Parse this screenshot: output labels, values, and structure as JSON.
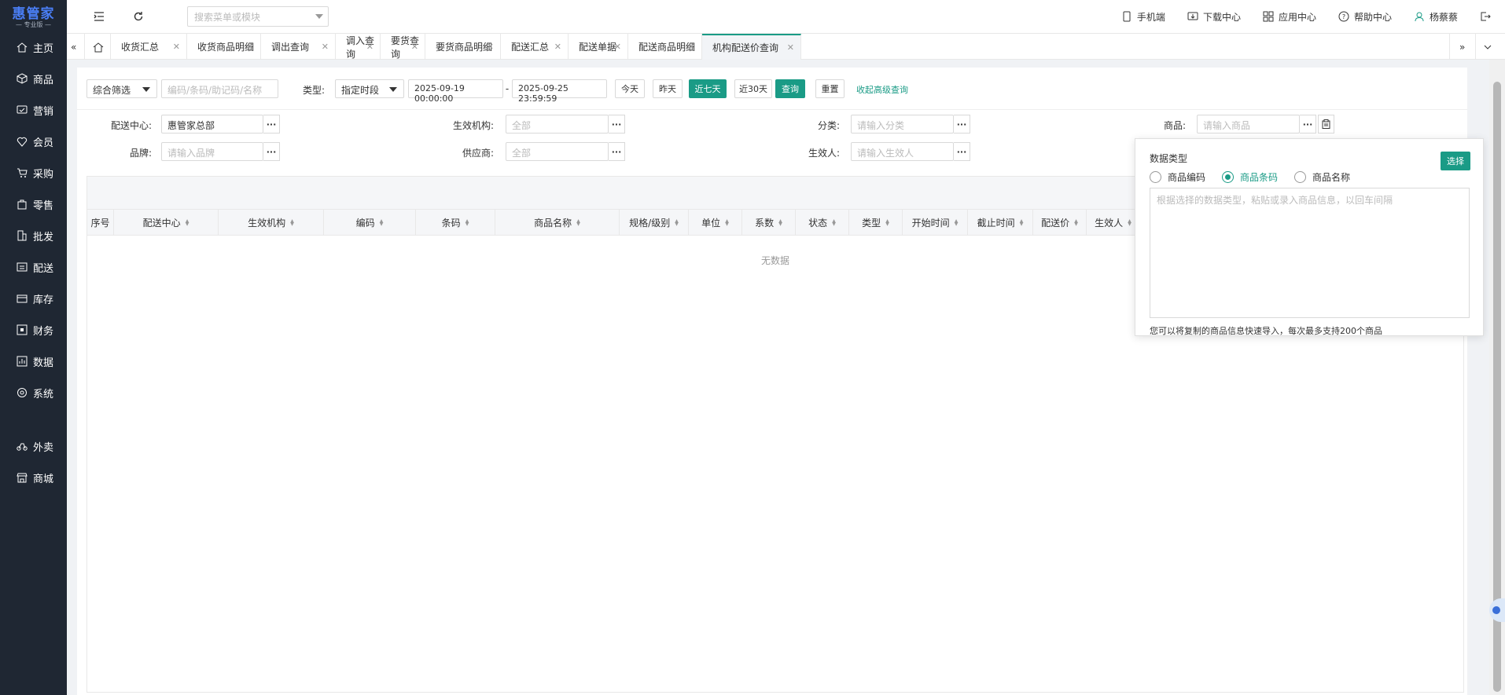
{
  "sidebar": {
    "logo_title": "惠管家",
    "logo_sub": "— 专业版 —",
    "items": [
      {
        "label": "主页",
        "icon": "home-icon"
      },
      {
        "label": "商品",
        "icon": "cube-icon"
      },
      {
        "label": "营销",
        "icon": "marketing-icon"
      },
      {
        "label": "会员",
        "icon": "member-icon"
      },
      {
        "label": "采购",
        "icon": "cart-icon"
      },
      {
        "label": "零售",
        "icon": "bag-icon"
      },
      {
        "label": "批发",
        "icon": "building-icon"
      },
      {
        "label": "配送",
        "icon": "truck-icon"
      },
      {
        "label": "库存",
        "icon": "box-icon"
      },
      {
        "label": "财务",
        "icon": "finance-icon"
      },
      {
        "label": "数据",
        "icon": "chart-icon"
      },
      {
        "label": "系统",
        "icon": "settings-icon"
      }
    ],
    "items2": [
      {
        "label": "外卖",
        "icon": "bike-icon"
      },
      {
        "label": "商城",
        "icon": "store-icon"
      }
    ]
  },
  "topbar": {
    "search_placeholder": "搜索菜单或模块",
    "links": [
      "手机端",
      "下载中心",
      "应用中心",
      "帮助中心",
      "杨蔡蔡"
    ]
  },
  "tabs": [
    "收货汇总",
    "收货商品明细",
    "调出查询",
    "调入查询",
    "要货查询",
    "要货商品明细",
    "配送汇总",
    "配送单据",
    "配送商品明细",
    "机构配送价查询"
  ],
  "filters": {
    "combo_label": "综合筛选",
    "code_placeholder": "编码/条码/助记码/名称",
    "type_label": "类型:",
    "type_value": "指定时段",
    "date_start": "2025-09-19 00:00:00",
    "date_sep": "-",
    "date_end": "2025-09-25 23:59:59",
    "btn_today": "今天",
    "btn_yesterday": "昨天",
    "btn_7days": "近七天",
    "btn_30days": "近30天",
    "btn_query": "查询",
    "btn_reset": "重置",
    "collapse_link": "收起高级查询",
    "center_label": "配送中心:",
    "center_value": "惠管家总部",
    "org_label": "生效机构:",
    "org_placeholder": "全部",
    "category_label": "分类:",
    "category_placeholder": "请输入分类",
    "product_label": "商品:",
    "product_placeholder": "请输入商品",
    "brand_label": "品牌:",
    "brand_placeholder": "请输入品牌",
    "supplier_label": "供应商:",
    "supplier_placeholder": "全部",
    "effector_label": "生效人:",
    "effector_placeholder": "请输入生效人",
    "dots": "···"
  },
  "table": {
    "columns": [
      "序号",
      "配送中心",
      "生效机构",
      "编码",
      "条码",
      "商品名称",
      "规格/级别",
      "单位",
      "系数",
      "状态",
      "类型",
      "开始时间",
      "截止时间",
      "配送价",
      "生效人"
    ],
    "empty_text": "无数据"
  },
  "popup": {
    "title": "数据类型",
    "select_btn": "选择",
    "options": [
      "商品编码",
      "商品条码",
      "商品名称"
    ],
    "selected": "商品条码",
    "placeholder": "根据选择的数据类型，粘贴或录入商品信息，以回车间隔",
    "hint": "您可以将复制的商品信息快速导入，每次最多支持200个商品"
  },
  "colors": {
    "accent": "#1a9b86",
    "sidebar_bg": "#1f2733",
    "logo": "#4a7ef5"
  }
}
